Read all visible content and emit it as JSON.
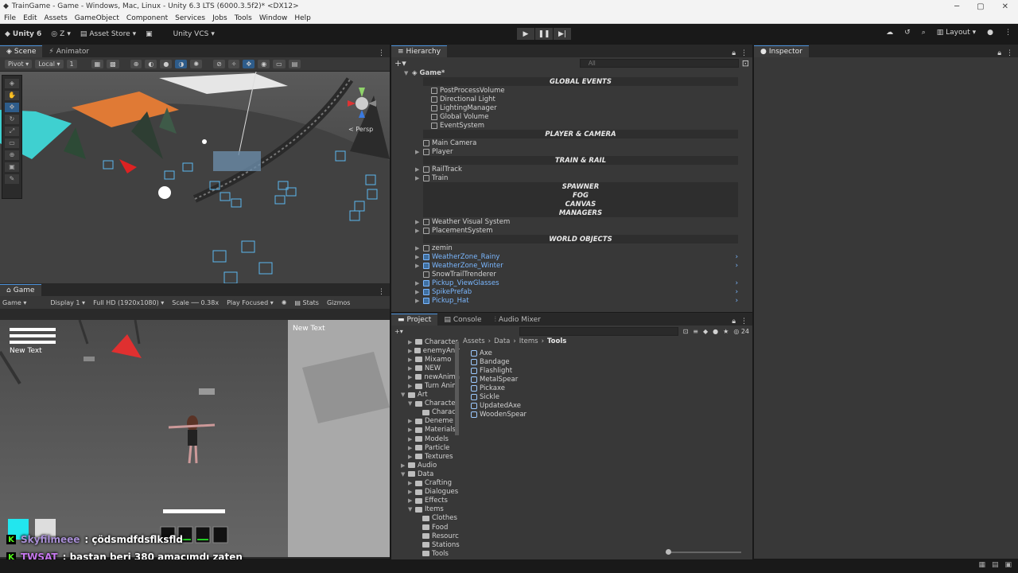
{
  "window": {
    "title": "TrainGame - Game - Windows, Mac, Linux - Unity 6.3 LTS (6000.3.5f2)* <DX12>"
  },
  "menu": [
    "File",
    "Edit",
    "Assets",
    "GameObject",
    "Component",
    "Services",
    "Jobs",
    "Tools",
    "Window",
    "Help"
  ],
  "toolbar": {
    "account": "Unity 6",
    "user": "Z",
    "asset_store": "Asset Store",
    "vcs": "Unity VCS",
    "layout": "Layout"
  },
  "scene": {
    "tabs": [
      "Scene",
      "Animator"
    ],
    "pivot": "Pivot",
    "local": "Local",
    "snap": "1",
    "persp": "< Persp"
  },
  "game": {
    "tab": "Game",
    "mode": "Game",
    "display": "Display 1",
    "resolution": "Full HD (1920x1080)",
    "scale_label": "Scale",
    "scale_value": "0.38x",
    "play_focused": "Play Focused",
    "stats": "Stats",
    "gizmos": "Gizmos",
    "new_text_1": "New Text",
    "new_text_2": "New Text",
    "chat": [
      {
        "user": "Skyfilmeee",
        "message": ": çödsmdfdsflksfld",
        "color": "#a98fd6"
      },
      {
        "user": "TWSAT",
        "message": ": baştan beri 380 amacımdı zaten",
        "color": "#c878f0"
      }
    ]
  },
  "hierarchy": {
    "tab": "Hierarchy",
    "search_placeholder": "All",
    "root": "Game*",
    "rows": [
      {
        "type": "sep",
        "label": "GLOBAL EVENTS"
      },
      {
        "type": "item",
        "label": "PostProcessVolume",
        "indent": 2
      },
      {
        "type": "item",
        "label": "Directional Light",
        "indent": 2
      },
      {
        "type": "item",
        "label": "LightingManager",
        "indent": 2
      },
      {
        "type": "item",
        "label": "Global Volume",
        "indent": 2
      },
      {
        "type": "item",
        "label": "EventSystem",
        "indent": 2
      },
      {
        "type": "sep",
        "label": "PLAYER & CAMERA"
      },
      {
        "type": "item",
        "label": "Main Camera",
        "indent": 1
      },
      {
        "type": "item",
        "label": "Player",
        "indent": 1,
        "arrow": true
      },
      {
        "type": "sep",
        "label": "TRAIN & RAIL"
      },
      {
        "type": "item",
        "label": "RailTrack",
        "indent": 1,
        "arrow": true
      },
      {
        "type": "item",
        "label": "Train",
        "indent": 1,
        "arrow": true
      },
      {
        "type": "sep",
        "label": "SPAWNER"
      },
      {
        "type": "sep",
        "label": "FOG"
      },
      {
        "type": "sep",
        "label": "CANVAS"
      },
      {
        "type": "sep",
        "label": "MANAGERS"
      },
      {
        "type": "item",
        "label": "Weather Visual System",
        "indent": 1,
        "arrow": true
      },
      {
        "type": "item",
        "label": "PlacementSystem",
        "indent": 1,
        "arrow": true
      },
      {
        "type": "sep",
        "label": "WORLD OBJECTS"
      },
      {
        "type": "item",
        "label": "zemin",
        "indent": 1,
        "arrow": true
      },
      {
        "type": "item",
        "label": "WeatherZone_Rainy",
        "indent": 1,
        "arrow": true,
        "blue": true
      },
      {
        "type": "item",
        "label": "WeatherZone_Winter",
        "indent": 1,
        "arrow": true,
        "blue": true
      },
      {
        "type": "item",
        "label": "SnowTrailTrenderer",
        "indent": 1
      },
      {
        "type": "item",
        "label": "Pickup_ViewGlasses",
        "indent": 1,
        "arrow": true,
        "blue": true
      },
      {
        "type": "item",
        "label": "SpikePrefab",
        "indent": 1,
        "arrow": true,
        "blue": true
      },
      {
        "type": "item",
        "label": "Pickup_Hat",
        "indent": 1,
        "arrow": true,
        "blue": true
      }
    ]
  },
  "project": {
    "tabs": [
      "Project",
      "Console",
      "Audio Mixer"
    ],
    "count": "24",
    "breadcrumb": [
      "Assets",
      "Data",
      "Items",
      "Tools"
    ],
    "tree": [
      {
        "label": "Character",
        "indent": 2
      },
      {
        "label": "enemyAnir",
        "indent": 2
      },
      {
        "label": "Mixamo",
        "indent": 2
      },
      {
        "label": "NEW",
        "indent": 2
      },
      {
        "label": "newAnima",
        "indent": 2
      },
      {
        "label": "Turn Anim",
        "indent": 2
      },
      {
        "label": "Art",
        "indent": 1,
        "open": true
      },
      {
        "label": "Character",
        "indent": 2,
        "open": true
      },
      {
        "label": "Charact",
        "indent": 3
      },
      {
        "label": "Deneme",
        "indent": 2
      },
      {
        "label": "Materials",
        "indent": 2
      },
      {
        "label": "Models",
        "indent": 2
      },
      {
        "label": "Particle",
        "indent": 2
      },
      {
        "label": "Textures",
        "indent": 2
      },
      {
        "label": "Audio",
        "indent": 1
      },
      {
        "label": "Data",
        "indent": 1,
        "open": true
      },
      {
        "label": "Crafting",
        "indent": 2
      },
      {
        "label": "Dialogues",
        "indent": 2
      },
      {
        "label": "Effects",
        "indent": 2
      },
      {
        "label": "Items",
        "indent": 2,
        "open": true
      },
      {
        "label": "Clothes",
        "indent": 3
      },
      {
        "label": "Food",
        "indent": 3
      },
      {
        "label": "Resourc",
        "indent": 3
      },
      {
        "label": "Stations",
        "indent": 3
      },
      {
        "label": "Tools",
        "indent": 3
      }
    ],
    "assets": [
      "Axe",
      "Bandage",
      "Flashlight",
      "MetalSpear",
      "Pickaxe",
      "Sickle",
      "UpdatedAxe",
      "WoodenSpear"
    ]
  },
  "inspector": {
    "tab": "Inspector"
  }
}
